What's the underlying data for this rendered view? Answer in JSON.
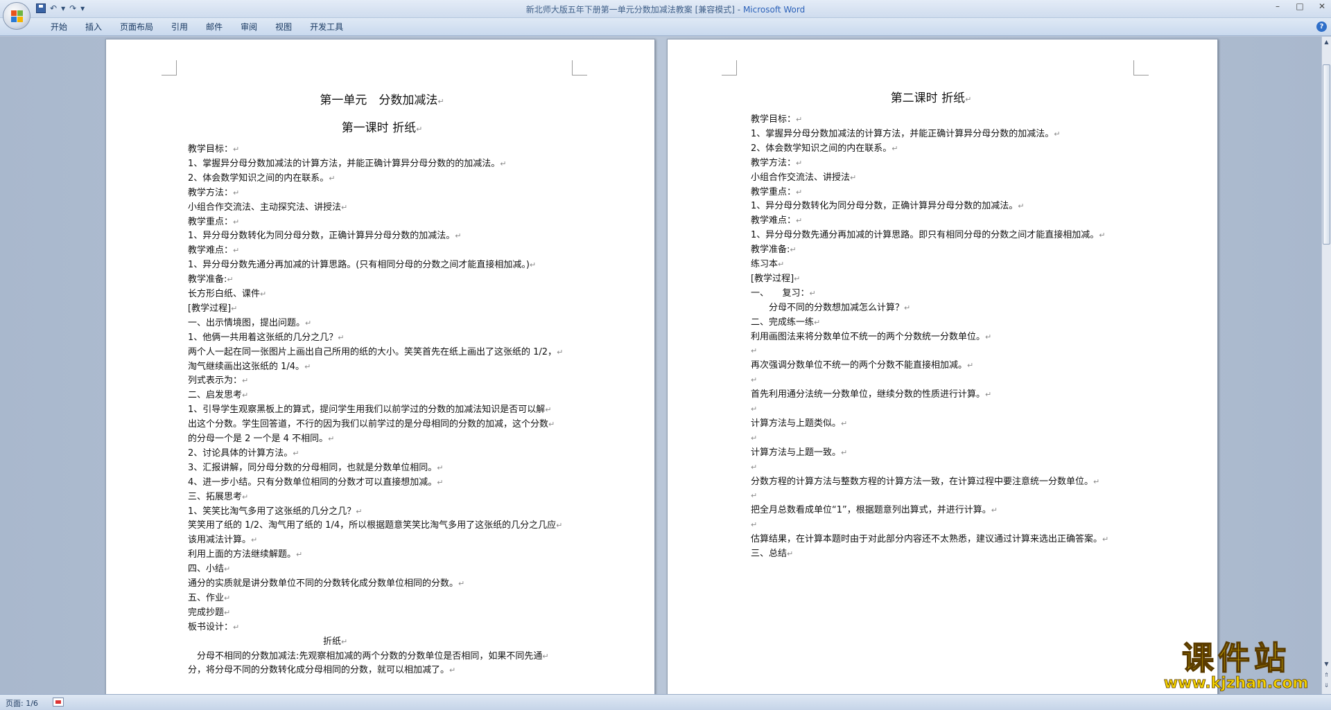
{
  "window": {
    "title_doc": "新北师大版五年下册第一单元分数加减法教案 [兼容模式]",
    "title_sep": " - ",
    "title_app": "Microsoft Word"
  },
  "ribbon": {
    "tabs": [
      "开始",
      "插入",
      "页面布局",
      "引用",
      "邮件",
      "审阅",
      "视图",
      "开发工具"
    ]
  },
  "page1": {
    "heading1": "第一单元　分数加减法",
    "heading2": "第一课时  折纸",
    "lines": [
      "教学目标：",
      "1、掌握异分母分数加减法的计算方法，并能正确计算异分母分数的的加减法。",
      "2、体会数学知识之间的内在联系。",
      "教学方法：",
      "小组合作交流法、主动探究法、讲授法",
      "教学重点：",
      "1、异分母分数转化为同分母分数，正确计算异分母分数的加减法。",
      "教学难点：",
      "1、异分母分数先通分再加减的计算思路。(只有相同分母的分数之间才能直接相加减。)",
      "教学准备:",
      "长方形白纸、课件",
      "[教学过程]",
      "一、出示情境图，提出问题。",
      "1、他俩一共用着这张纸的几分之几？",
      "两个人一起在同一张图片上画出自己所用的纸的大小。笑笑首先在纸上画出了这张纸的 1/2，",
      "淘气继续画出这张纸的 1/4。",
      "列式表示为：",
      "二、启发思考",
      "1、引导学生观察黑板上的算式，提问学生用我们以前学过的分数的加减法知识是否可以解",
      "出这个分数。学生回答道，不行的因为我们以前学过的是分母相同的分数的加减，这个分数",
      "的分母一个是 2 一个是 4 不相同。",
      "2、讨论具体的计算方法。",
      "3、汇报讲解，同分母分数的分母相同，也就是分数单位相同。",
      "4、进一步小结。只有分数单位相同的分数才可以直接想加减。",
      "三、拓展思考",
      "1、笑笑比淘气多用了这张纸的几分之几？",
      "笑笑用了纸的 1/2、淘气用了纸的 1/4，所以根据题意笑笑比淘气多用了这张纸的几分之几应",
      "该用减法计算。",
      "利用上面的方法继续解题。",
      "四、小结",
      "通分的实质就是讲分数单位不同的分数转化成分数单位相同的分数。",
      "五、作业",
      "完成抄题",
      "板书设计：",
      "折纸",
      "　分母不相同的分数加减法:先观察相加减的两个分数的分数单位是否相同，如果不同先通",
      "分，将分母不同的分数转化成分母相同的分数，就可以相加减了。"
    ]
  },
  "page2": {
    "heading": "第二课时  折纸",
    "lines": [
      "教学目标：",
      "1、掌握异分母分数加减法的计算方法，并能正确计算异分母分数的加减法。",
      "2、体会数学知识之间的内在联系。",
      "教学方法：",
      "小组合作交流法、讲授法",
      "教学重点：",
      "1、异分母分数转化为同分母分数，正确计算异分母分数的加减法。",
      "教学难点：",
      "1、异分母分数先通分再加减的计算思路。即只有相同分母的分数之间才能直接相加减。",
      "教学准备:",
      "练习本",
      "[教学过程]",
      "一、　　复习：",
      "　　分母不同的分数想加减怎么计算？",
      "二、完成练一练",
      "利用画图法来将分数单位不统一的两个分数统一分数单位。",
      "",
      "再次强调分数单位不统一的两个分数不能直接相加减。",
      "",
      "首先利用通分法统一分数单位，继续分数的性质进行计算。",
      "",
      "计算方法与上题类似。",
      "",
      "计算方法与上题一致。",
      "",
      "分数方程的计算方法与整数方程的计算方法一致，在计算过程中要注意统一分数单位。",
      "",
      "把全月总数看成单位“1”，根据题意列出算式，并进行计算。",
      "",
      "估算结果，在计算本题时由于对此部分内容还不太熟悉，建议通过计算来选出正确答案。",
      "三、总结"
    ]
  },
  "paragraph_mark": "↵",
  "status": {
    "page": "页面: 1/6"
  },
  "watermark": {
    "text": "课件站",
    "url": "www.kjzhan.com"
  }
}
